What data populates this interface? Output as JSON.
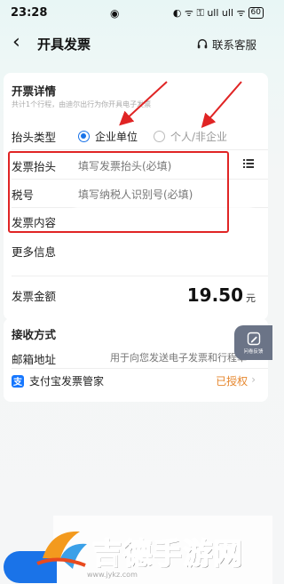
{
  "status": {
    "time": "23:28",
    "icons": "◐ ᯤ ⚿ ull ull ᯤ",
    "battery": "60"
  },
  "nav": {
    "back_icon": "chevron-left-icon",
    "title": "开具发票",
    "service_label": "联系客服"
  },
  "invoice": {
    "section_title": "开票详情",
    "hint": "共计1个行程，由迪尔出行为你开具电子发票",
    "header_type_label": "抬头类型",
    "options": [
      {
        "label": "企业单位",
        "selected": true
      },
      {
        "label": "个人/非企业",
        "selected": false
      }
    ],
    "header_label": "发票抬头",
    "header_placeholder": "填写发票抬头(必填)",
    "tax_label": "税号",
    "tax_placeholder": "填写纳税人识别号(必填)",
    "content_label": "发票内容",
    "more_label": "更多信息",
    "amount_label": "发票金额",
    "amount_value": "19.50",
    "amount_unit": "元"
  },
  "receive": {
    "section_title": "接收方式",
    "email_label": "邮箱地址",
    "email_hint": "用于向您发送电子发票和行程单",
    "alipay_label": "支付宝发票管家",
    "alipay_status": "已授权"
  },
  "fab": {
    "label": "问卷反馈"
  },
  "watermark": {
    "text": "吉德手游网",
    "url": "www.jykz.com"
  },
  "colors": {
    "accent": "#1a73e8",
    "highlight": "#e02424",
    "authorized": "#e6872e"
  }
}
